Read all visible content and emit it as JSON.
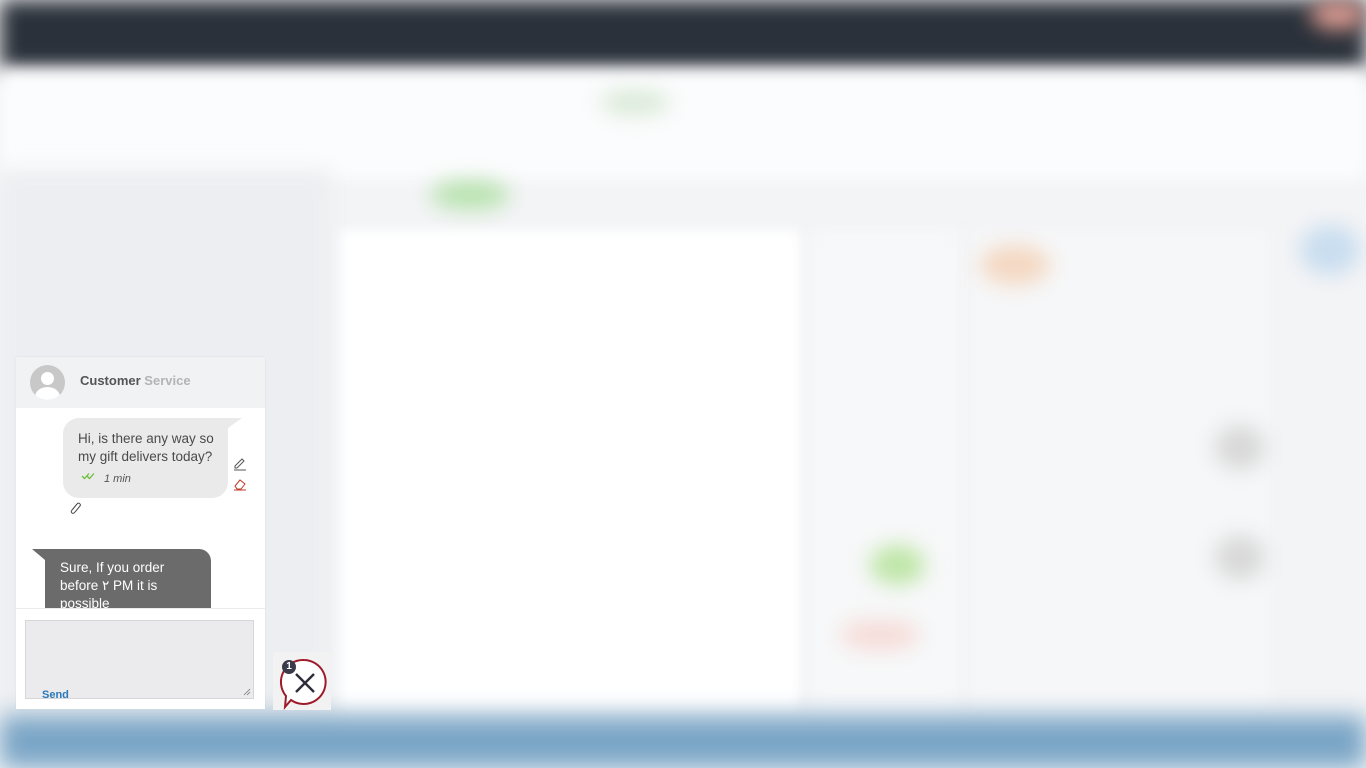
{
  "chat": {
    "title_part1": "Customer ",
    "title_part2": "Service",
    "messages": [
      {
        "from": "user",
        "text": "Hi, is there any way so my gift delivers today?",
        "time": "1 min",
        "status": "read"
      },
      {
        "from": "agent",
        "text": "Sure, If you order before ۲ PM it is possible"
      }
    ],
    "compose": {
      "value": "",
      "send_label": "Send"
    },
    "unread_count": "1"
  },
  "icons": {
    "avatar": "user-avatar-icon",
    "edit": "pencil-icon",
    "delete": "eraser-icon",
    "attach": "paperclip-icon",
    "read": "double-check-icon",
    "close": "chat-close-icon"
  },
  "colors": {
    "accent": "#2a79b8",
    "read_check": "#6bbf3d",
    "close_ring": "#9e1b2a",
    "agent_bubble": "#6b6b6b",
    "user_bubble": "#eaeaea"
  }
}
